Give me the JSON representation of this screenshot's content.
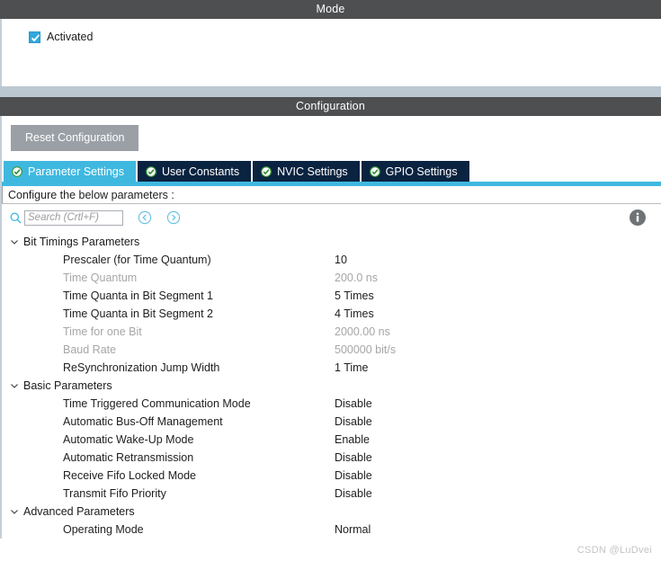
{
  "mode_panel": {
    "title": "Mode",
    "activated": {
      "label": "Activated",
      "checked": true,
      "checkbox_color": "#31a8dd"
    }
  },
  "config_panel": {
    "title": "Configuration",
    "reset_button": "Reset Configuration",
    "tabs": [
      {
        "label": "Parameter Settings",
        "active": true,
        "icon": "check-circle-icon"
      },
      {
        "label": "User Constants",
        "active": false,
        "icon": "check-circle-icon"
      },
      {
        "label": "NVIC Settings",
        "active": false,
        "icon": "check-circle-icon"
      },
      {
        "label": "GPIO Settings",
        "active": false,
        "icon": "check-circle-icon"
      }
    ],
    "active_tab_color": "#3fb8e0",
    "inactive_tab_color": "#0a2340",
    "configure_label": "Configure the below parameters :",
    "search": {
      "placeholder": "Search (Crtl+F)",
      "value": "",
      "icon": "search-icon",
      "prev_icon": "chevron-left-circle-icon",
      "next_icon": "chevron-right-circle-icon"
    },
    "info_icon": "info-icon"
  },
  "parameters": [
    {
      "group": "Bit Timings Parameters",
      "expanded": true,
      "rows": [
        {
          "name": "Prescaler (for Time Quantum)",
          "value": "10",
          "readonly": false
        },
        {
          "name": "Time Quantum",
          "value": "200.0 ns",
          "readonly": true
        },
        {
          "name": "Time Quanta in Bit Segment 1",
          "value": "5 Times",
          "readonly": false
        },
        {
          "name": "Time Quanta in Bit Segment 2",
          "value": "4 Times",
          "readonly": false
        },
        {
          "name": "Time for one Bit",
          "value": "2000.00 ns",
          "readonly": true
        },
        {
          "name": "Baud Rate",
          "value": "500000 bit/s",
          "readonly": true
        },
        {
          "name": "ReSynchronization Jump Width",
          "value": "1 Time",
          "readonly": false
        }
      ]
    },
    {
      "group": "Basic Parameters",
      "expanded": true,
      "rows": [
        {
          "name": "Time Triggered Communication Mode",
          "value": "Disable",
          "readonly": false
        },
        {
          "name": "Automatic Bus-Off Management",
          "value": "Disable",
          "readonly": false
        },
        {
          "name": "Automatic Wake-Up Mode",
          "value": "Enable",
          "readonly": false
        },
        {
          "name": "Automatic Retransmission",
          "value": "Disable",
          "readonly": false
        },
        {
          "name": "Receive Fifo Locked Mode",
          "value": "Disable",
          "readonly": false
        },
        {
          "name": "Transmit Fifo Priority",
          "value": "Disable",
          "readonly": false
        }
      ]
    },
    {
      "group": "Advanced Parameters",
      "expanded": true,
      "rows": [
        {
          "name": "Operating Mode",
          "value": "Normal",
          "readonly": false
        }
      ]
    }
  ],
  "watermark": "CSDN @LuDvei"
}
